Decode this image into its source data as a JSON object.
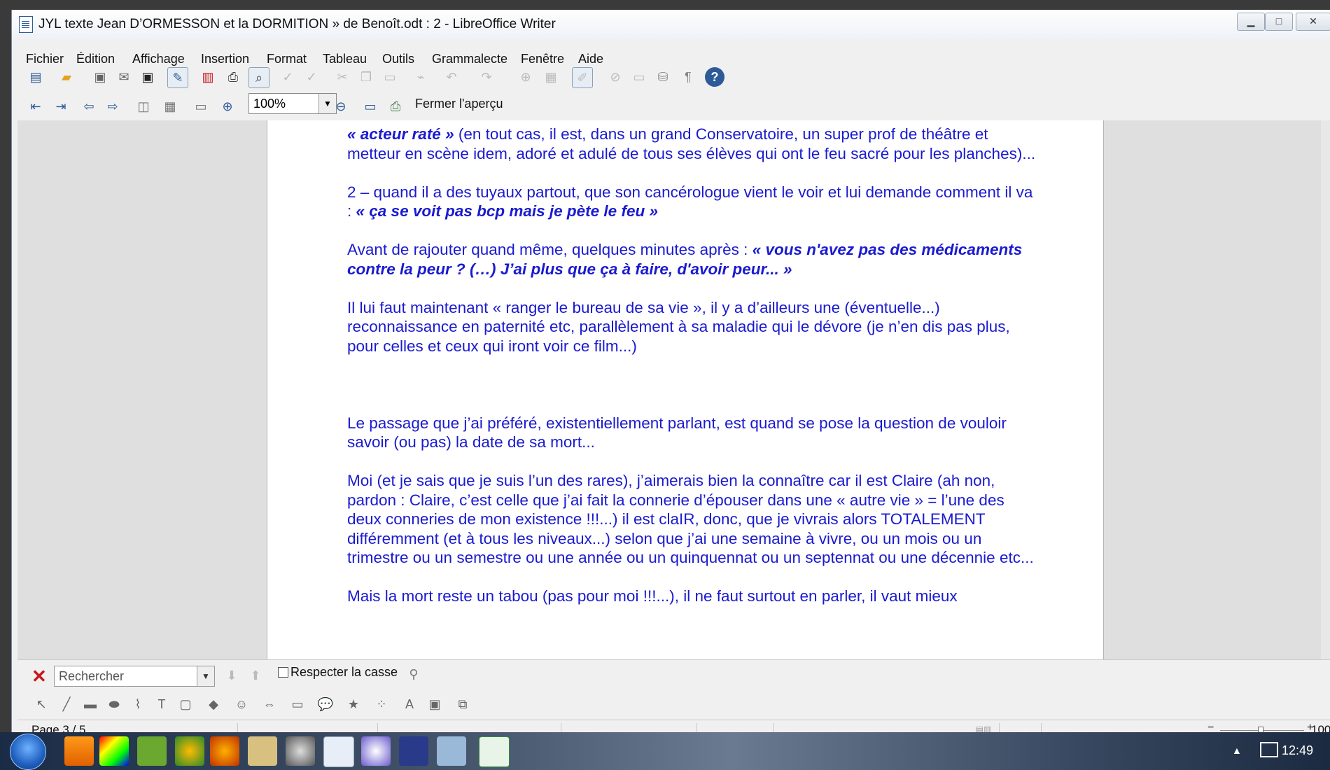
{
  "window": {
    "title": "JYL   texte Jean D’ORMESSON et la DORMITION » de Benoît.odt : 2 - LibreOffice Writer",
    "minimize_icon": "minimize-icon",
    "maximize_icon": "maximize-icon",
    "close_icon": "close-icon"
  },
  "menu": [
    "Fichier",
    "Édition",
    "Affichage",
    "Insertion",
    "Format",
    "Tableau",
    "Outils",
    "Grammalecte",
    "Fenêtre",
    "Aide"
  ],
  "preview_toolbar": {
    "zoom_value": "100%",
    "close_preview_label": "Fermer l'aperçu"
  },
  "document": {
    "paragraphs": [
      {
        "italic_start": "« acteur raté »",
        "rest": " (en tout cas, il est, dans un grand Conservatoire,  un super prof de théâtre et metteur en scène idem, adoré et adulé de tous ses élèves qui ont le feu sacré pour les planches)..."
      },
      {
        "plain": "2 – quand il a des tuyaux partout, que son cancérologue vient le voir et lui demande comment il va : ",
        "italic_end": "« ça se voit pas bcp mais je pète le feu »"
      },
      {
        "plain": "Avant de rajouter quand même, quelques minutes après : ",
        "italic_end": "« vous n'avez pas des médicaments contre la peur ?  (…) J’ai plus que ça à faire, d'avoir peur... »"
      },
      {
        "plain": "Il lui faut maintenant « ranger le bureau de sa vie », il y a d’ailleurs une (éventuelle...) reconnaissance en paternité etc, parallèlement à sa maladie qui le dévore (je n’en dis pas plus, pour celles et ceux qui iront voir ce film...)"
      },
      {
        "plain": "Le passage que j’ai préféré, existentiellement parlant, est quand se pose la question de vouloir savoir (ou pas) la date de sa mort..."
      },
      {
        "plain": "Moi (et je sais que je suis l’un des rares), j’aimerais bien la connaître car il est Claire (ah non, pardon : Claire, c’est celle que j’ai fait la connerie d’épouser dans une « autre vie » = l’une des deux conneries de mon existence !!!...) il est claIR, donc, que je vivrais alors TOTALEMENT différemment (et à tous les niveaux...)  selon que j’ai une semaine à vivre, ou un mois ou un trimestre ou un semestre ou une année ou un quinquennat ou un septennat ou une décennie etc..."
      },
      {
        "plain": "Mais la mort reste un tabou (pas pour moi !!!...), il ne faut surtout en parler, il vaut mieux"
      }
    ]
  },
  "findbar": {
    "search_placeholder": "Rechercher",
    "match_case_label": "Respecter la casse"
  },
  "status": {
    "page": "Page 3 / 5",
    "zoom": "100"
  },
  "taskbar": {
    "time": "12:49"
  },
  "colors": {
    "text": "#1a1ad0",
    "close_x": "#c8161d"
  }
}
